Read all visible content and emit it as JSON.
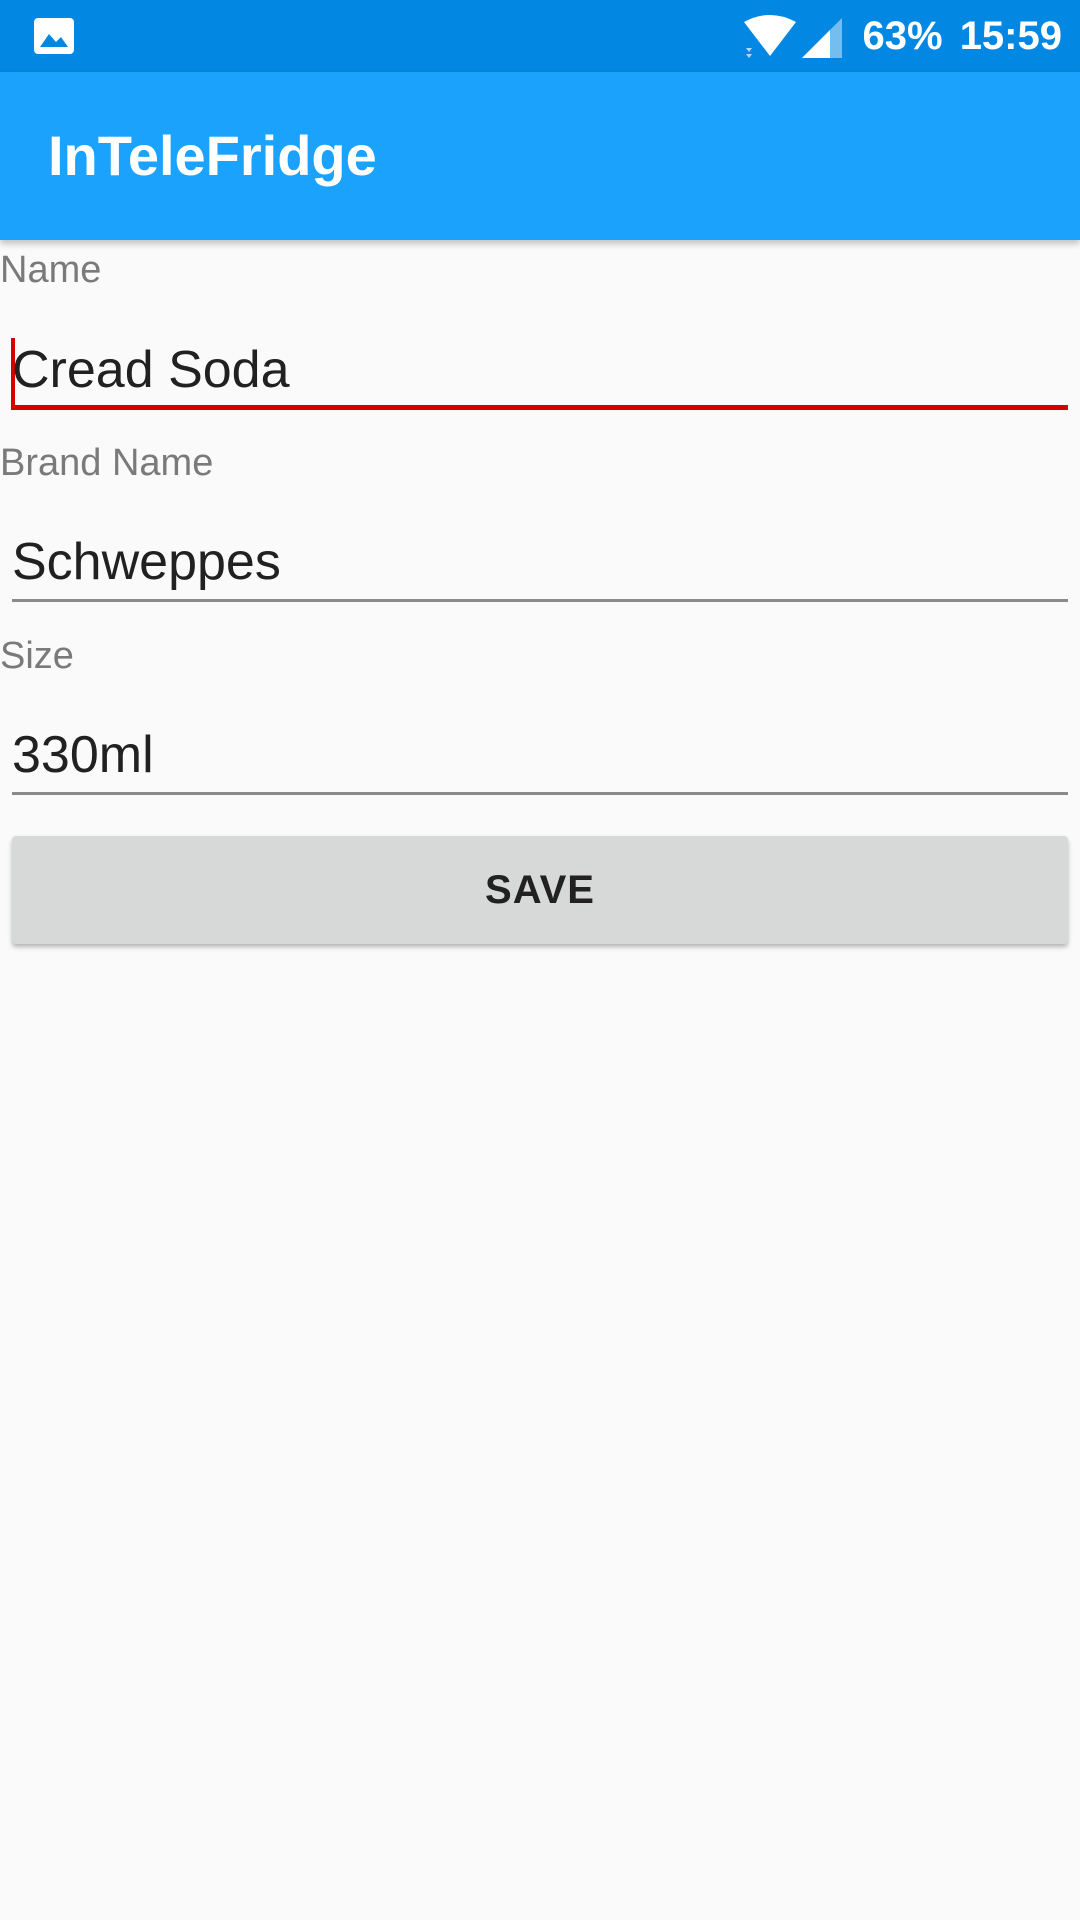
{
  "status_bar": {
    "left_icon": "image-icon",
    "wifi_icon": "wifi-icon",
    "signal_icon": "cell-signal-icon",
    "battery": "63%",
    "time": "15:59"
  },
  "app_bar": {
    "title": "InTeleFridge",
    "color": "#1BA2FC"
  },
  "form": {
    "name": {
      "label": "Name",
      "value": "Cread Soda",
      "focused": true,
      "accent_color": "#D50000"
    },
    "brand": {
      "label": "Brand Name",
      "value": "Schweppes"
    },
    "size": {
      "label": "Size",
      "value": "330ml"
    },
    "save_label": "SAVE"
  }
}
